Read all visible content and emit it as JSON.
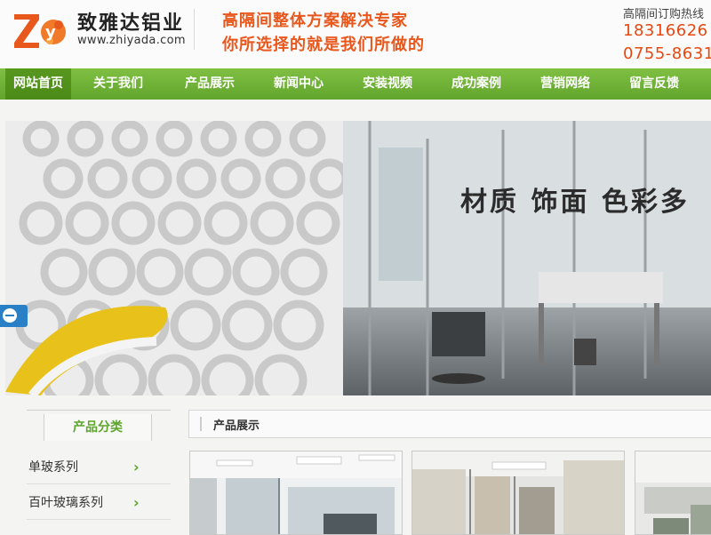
{
  "brand": {
    "name": "致雅达铝业",
    "url": "www.zhiyada.com",
    "logo_letters": "Zy",
    "accent_red": "#e8571c",
    "accent_green": "#6aae2f"
  },
  "slogans": [
    "高隔间整体方案解决专家",
    "你所选择的就是我们所做的"
  ],
  "hotline": {
    "label": "高隔间订购热线",
    "numbers": [
      "18316626",
      "0755-8631"
    ]
  },
  "nav": {
    "items": [
      "网站首页",
      "关于我们",
      "产品展示",
      "新闻中心",
      "安装视频",
      "成功案例",
      "营销网络",
      "留言反馈"
    ],
    "active_index": 0
  },
  "banner": {
    "caption": "材质 饰面 色彩多"
  },
  "category": {
    "title": "产品分类",
    "items": [
      "单玻系列",
      "百叶玻璃系列"
    ],
    "chevron": "›"
  },
  "products": {
    "title": "产品展示",
    "thumbnails": [
      "office-glass-partition-photo",
      "corridor-partition-photo",
      "open-office-photo"
    ]
  }
}
